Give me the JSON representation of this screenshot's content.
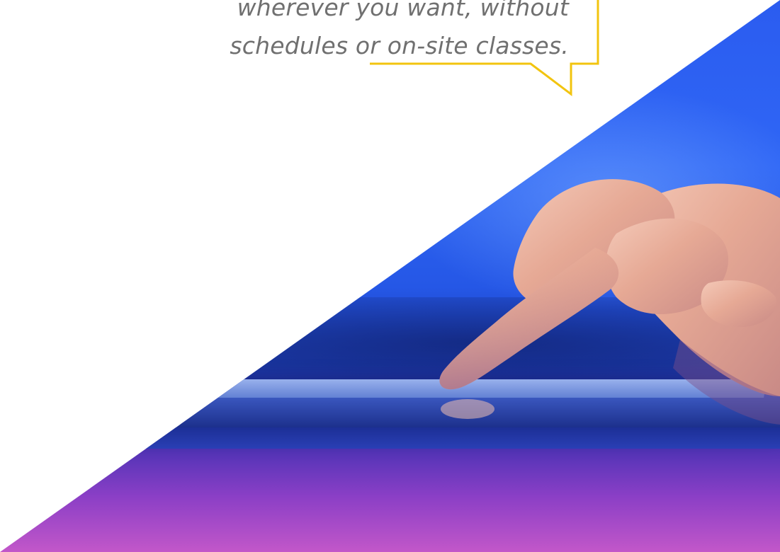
{
  "callout": {
    "line1": "wherever you want, without",
    "line2": "schedules or on-site classes.",
    "border_color": "#f2c40f",
    "text_color": "#707070"
  },
  "hero": {
    "image_subject": "finger-touching-tablet",
    "colors": {
      "blue": "#2f66f5",
      "deep_blue": "#1e3fb8",
      "purple": "#8b3fc6",
      "magenta": "#c257c9"
    }
  }
}
